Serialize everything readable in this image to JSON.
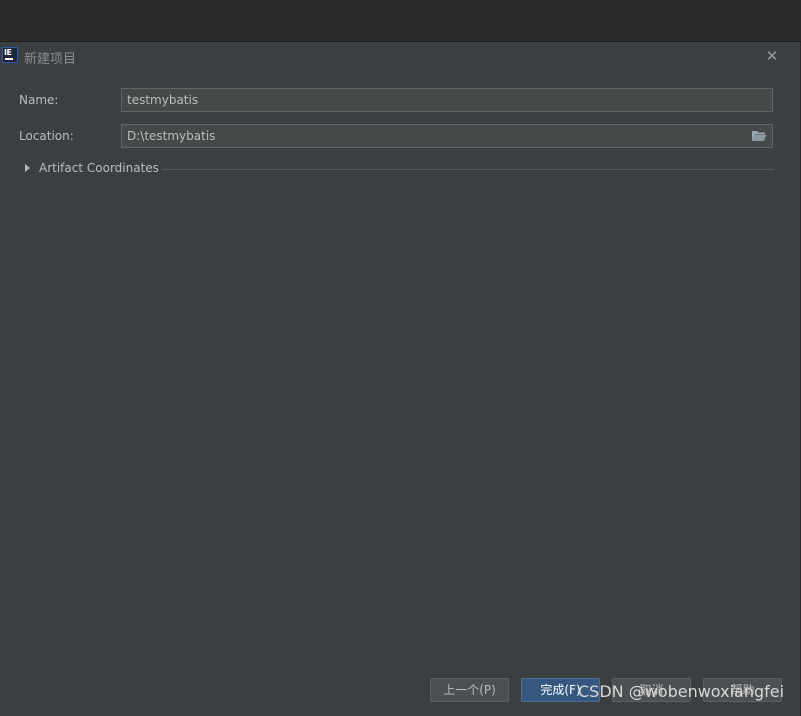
{
  "window": {
    "title": "新建项目",
    "app_icon": "intellij-idea-icon",
    "close_icon": "close-icon"
  },
  "form": {
    "name_label": "Name:",
    "name_value": "testmybatis",
    "location_label": "Location:",
    "location_value": "D:\\testmybatis",
    "browse_icon": "folder-open-icon",
    "artifact_label": "Artifact Coordinates",
    "artifact_expanded": false
  },
  "footer": {
    "previous_label": "上一个(P)",
    "finish_label": "完成(F)",
    "cancel_label": "取消",
    "help_label": "帮助"
  },
  "watermark": {
    "text": "CSDN @wobenwoxiangfei"
  },
  "colors": {
    "dialog_bg": "#3c3f41",
    "input_bg": "#45494a",
    "primary_button": "#365880"
  }
}
